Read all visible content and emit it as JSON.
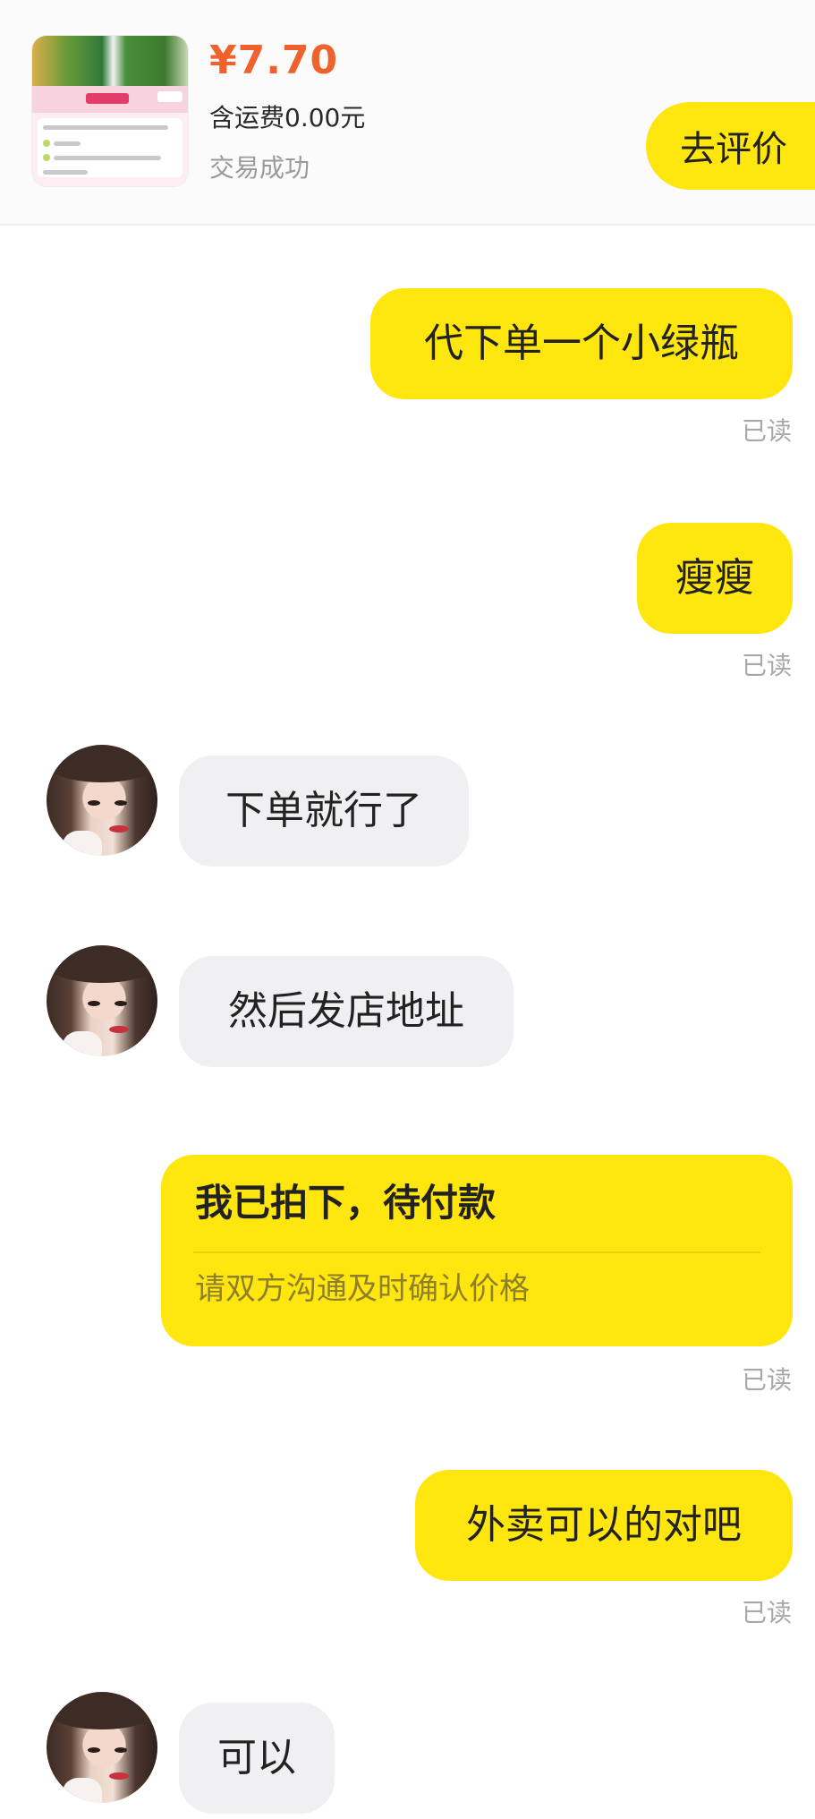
{
  "order": {
    "price": "¥7.70",
    "shipping": "含运费0.00元",
    "status": "交易成功",
    "review_button": "去评价"
  },
  "messages": [
    {
      "side": "out",
      "text": "代下单一个小绿瓶",
      "read": "已读"
    },
    {
      "side": "out",
      "text": "瘦瘦",
      "read": "已读"
    },
    {
      "side": "in",
      "text": "下单就行了"
    },
    {
      "side": "in",
      "text": "然后发店地址"
    },
    {
      "side": "out",
      "type": "order-card",
      "title": "我已拍下，待付款",
      "subtitle": "请双方沟通及时确认价格",
      "read": "已读"
    },
    {
      "side": "out",
      "text": "外卖可以的对吧",
      "read": "已读"
    },
    {
      "side": "in",
      "text": "可以"
    }
  ],
  "colors": {
    "accent_yellow": "#ffe60f",
    "price_orange": "#f0622d",
    "incoming_bubble": "#f0f0f3",
    "read_gray": "#a8a8a8"
  }
}
